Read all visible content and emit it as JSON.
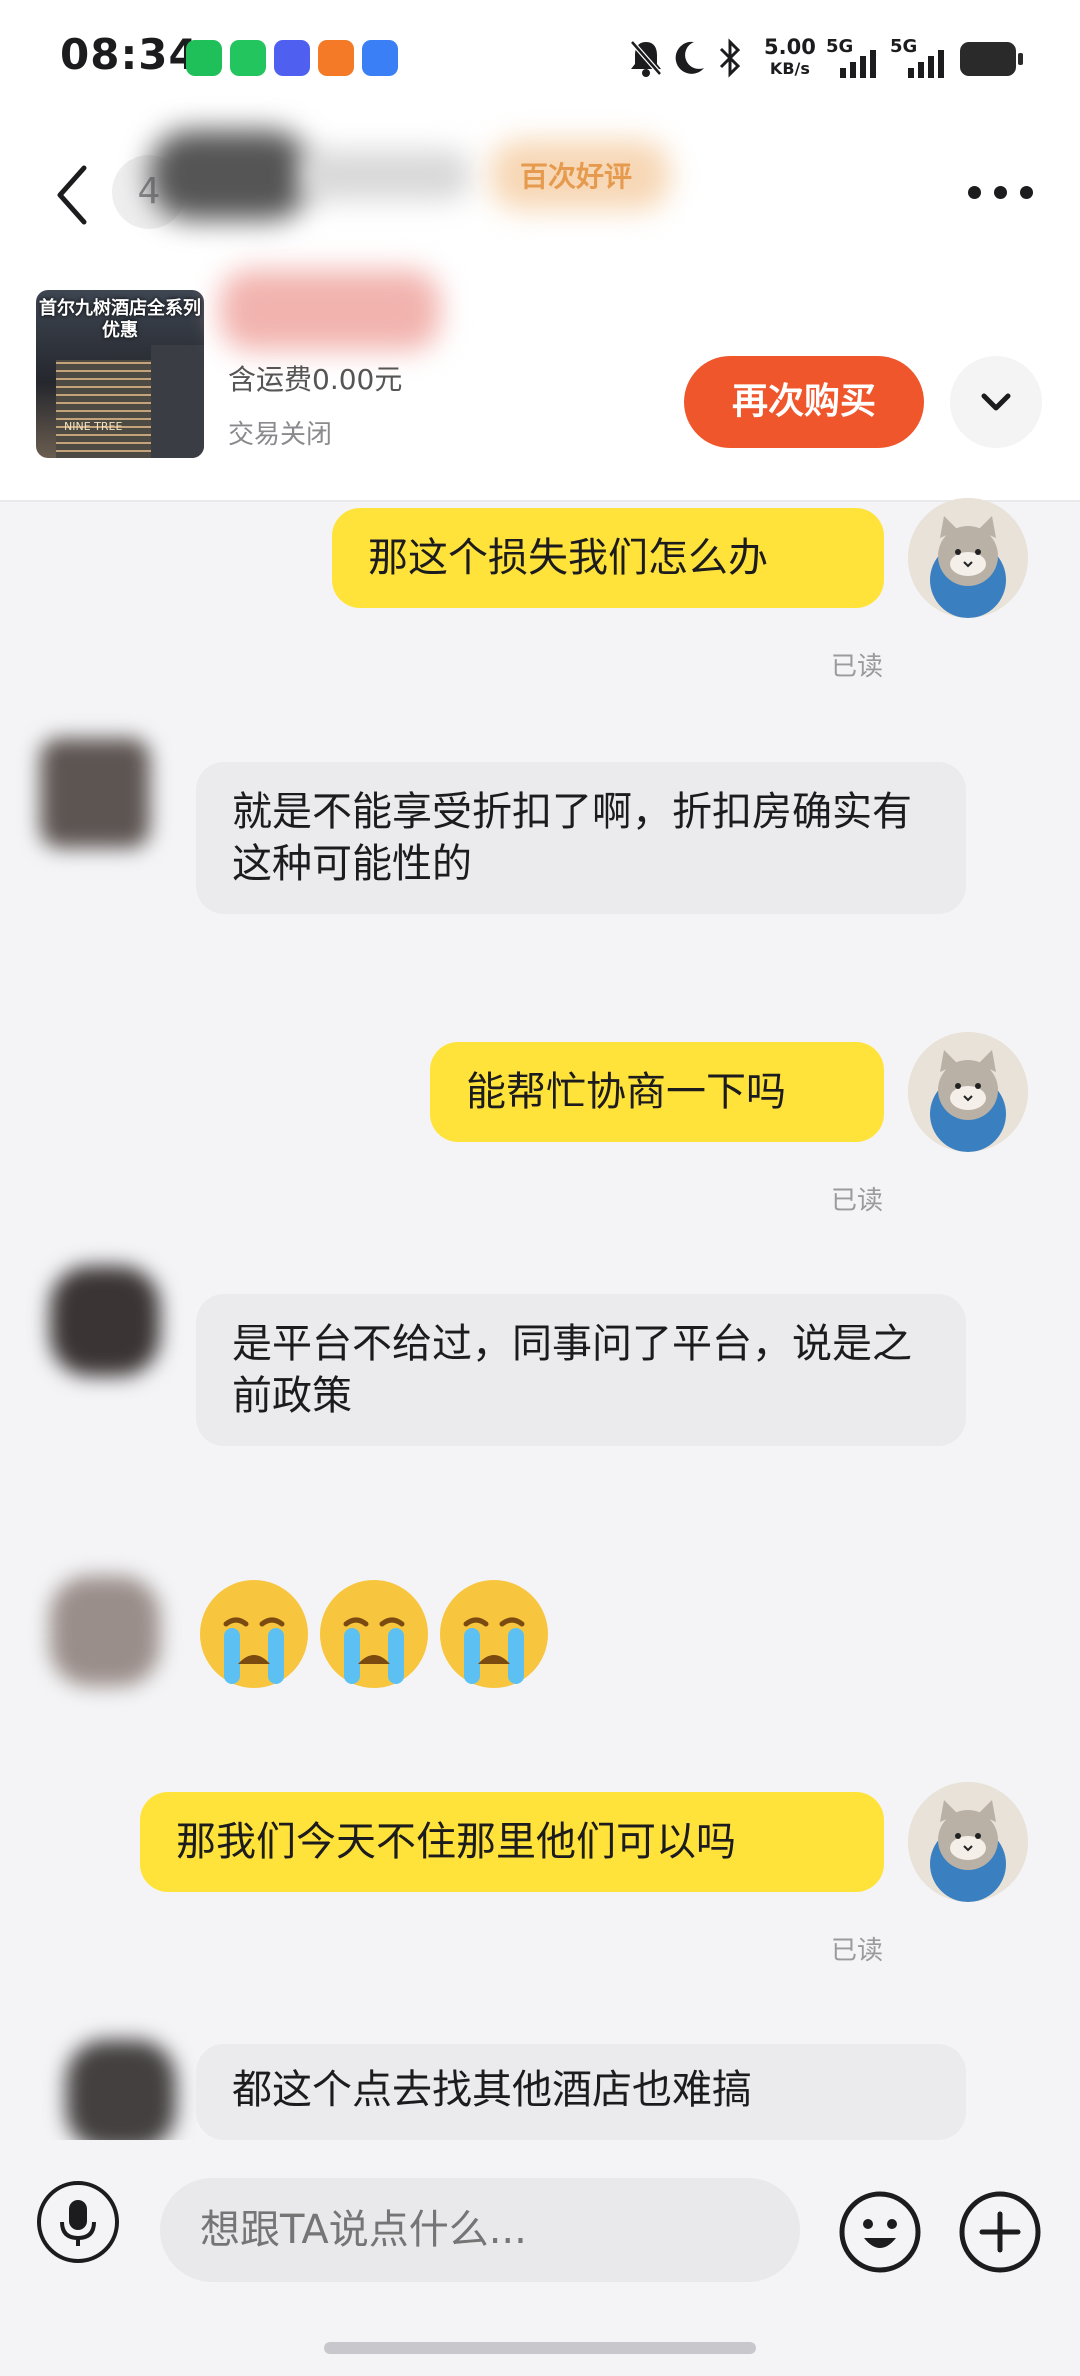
{
  "status_bar": {
    "time": "08:34",
    "net_speed": "5.00",
    "net_unit": "KB/s",
    "signal_1": "5G",
    "signal_2": "5G"
  },
  "header": {
    "unread_count": "4",
    "rating_badge": "百次好评",
    "order": {
      "thumbnail_caption": "首尔九树酒店全系列优惠",
      "thumbnail_sign": "NINE TREE",
      "shipping": "含运费0.00元",
      "status": "交易关闭",
      "rebuy_label": "再次购买"
    }
  },
  "messages": [
    {
      "from": "me",
      "text": "那这个损失我们怎么办",
      "receipt": "已读"
    },
    {
      "from": "them",
      "text": "就是不能享受折扣了啊，折扣房确实有这种可能性的"
    },
    {
      "from": "me",
      "text": "能帮忙协商一下吗",
      "receipt": "已读"
    },
    {
      "from": "them",
      "text": "是平台不给过，同事问了平台，说是之前政策"
    },
    {
      "from": "them",
      "emoji": [
        "crying-face",
        "crying-face",
        "crying-face"
      ]
    },
    {
      "from": "me",
      "text": "那我们今天不住那里他们可以吗",
      "receipt": "已读"
    },
    {
      "from": "them",
      "text": "都这个点去找其他酒店也难搞"
    }
  ],
  "input": {
    "placeholder": "想跟TA说点什么..."
  },
  "colors": {
    "my_bubble": "#ffe33a",
    "their_bubble": "#ebebee",
    "rebuy_button": "#f0562c",
    "rating_text": "#e0862b"
  },
  "icons": [
    "back-arrow-icon",
    "more-dots-icon",
    "chevron-down-icon",
    "microphone-icon",
    "smiley-icon",
    "plus-icon",
    "wechat-icon",
    "phone-icon",
    "vivo-icon",
    "app-icon",
    "browser-icon",
    "mute-bell-icon",
    "moon-icon",
    "bluetooth-icon",
    "signal-icon",
    "battery-icon"
  ]
}
